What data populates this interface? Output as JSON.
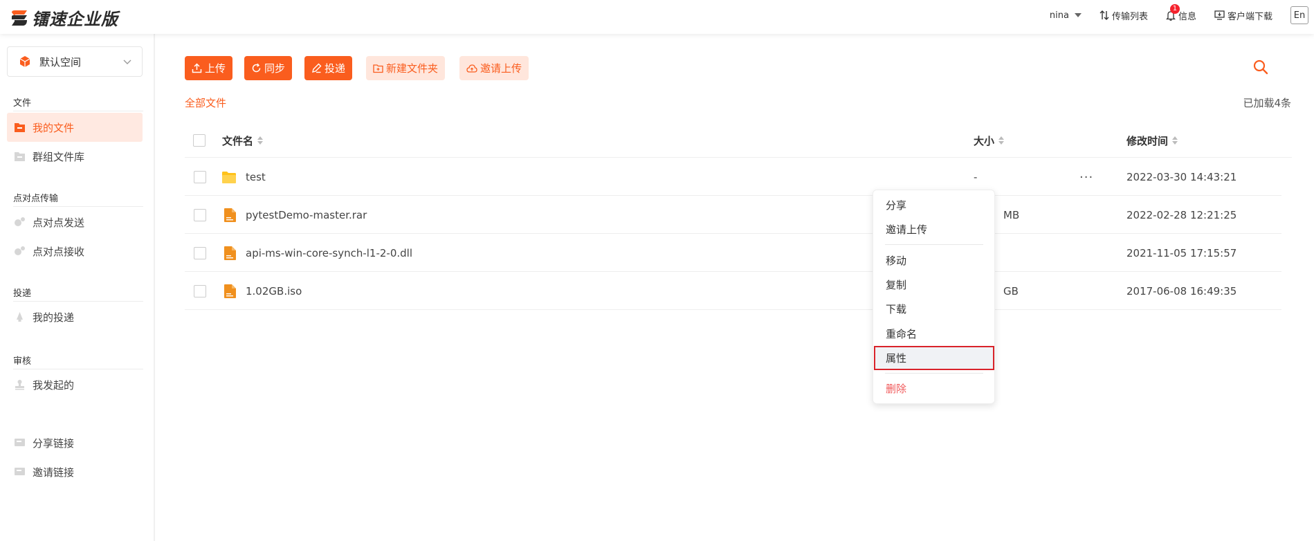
{
  "app": {
    "logo_text": "镭速企业版",
    "brand_color": "#fa5d1e"
  },
  "header": {
    "user": "nina",
    "transfer_list": "传输列表",
    "messages": "信息",
    "messages_badge": "1",
    "client_download": "客户端下载",
    "language": "En"
  },
  "sidebar": {
    "space_selector": "默认空间",
    "sections": {
      "files": "文件",
      "p2p": "点对点传输",
      "delivery": "投递",
      "review": "审核"
    },
    "items": {
      "my_files": "我的文件",
      "group_library": "群组文件库",
      "p2p_send": "点对点发送",
      "p2p_receive": "点对点接收",
      "my_delivery": "我的投递",
      "my_initiated": "我发起的",
      "share_links": "分享链接",
      "invite_links": "邀请链接"
    }
  },
  "toolbar": {
    "upload": "上传",
    "sync": "同步",
    "deliver": "投递",
    "new_folder": "新建文件夹",
    "invite_upload": "邀请上传"
  },
  "breadcrumb": "全部文件",
  "loaded_count": "已加载4条",
  "table": {
    "columns": {
      "name": "文件名",
      "size": "大小",
      "modified": "修改时间"
    },
    "rows": [
      {
        "name": "test",
        "type": "folder",
        "size": "-",
        "modified": "2022-03-30 14:43:21",
        "more": "···"
      },
      {
        "name": "pytestDemo-master.rar",
        "type": "file",
        "size": "MB",
        "modified": "2022-02-28 12:21:25"
      },
      {
        "name": "api-ms-win-core-synch-l1-2-0.dll",
        "type": "file",
        "size": "",
        "modified": "2021-11-05 17:15:57"
      },
      {
        "name": "1.02GB.iso",
        "type": "file",
        "size": "GB",
        "modified": "2017-06-08 16:49:35"
      }
    ]
  },
  "context_menu": {
    "share": "分享",
    "invite_upload": "邀请上传",
    "move": "移动",
    "copy": "复制",
    "download": "下载",
    "rename": "重命名",
    "properties": "属性",
    "delete": "删除"
  }
}
